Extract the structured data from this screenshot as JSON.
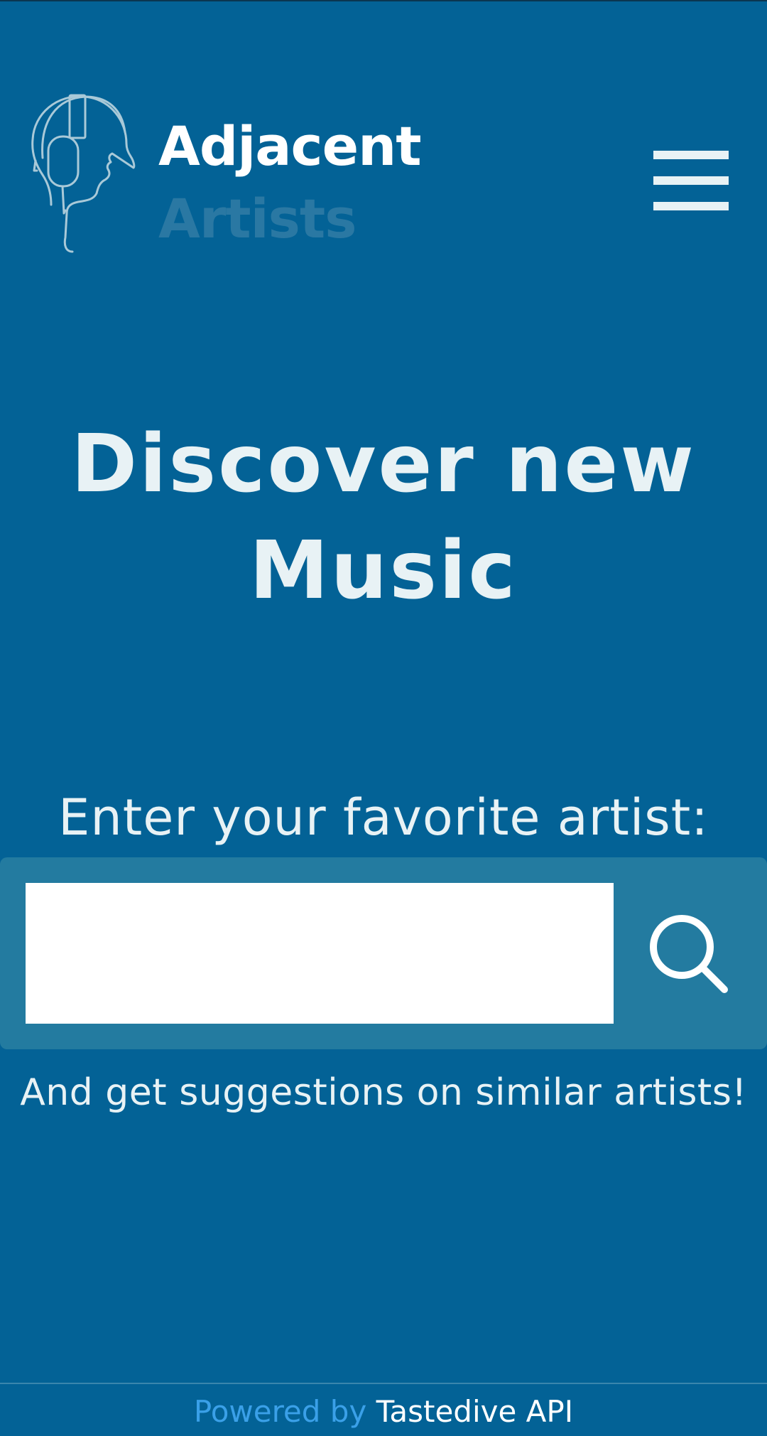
{
  "header": {
    "logo_line1": "Adjacent",
    "logo_line2": "Artists",
    "logo_icon": "headphones-head-icon",
    "menu_icon": "hamburger-menu-icon"
  },
  "hero": {
    "title": "Discover new Music"
  },
  "search": {
    "label": "Enter your favorite artist:",
    "input_value": "",
    "placeholder": "",
    "button_icon": "search-icon"
  },
  "subtext": "And get suggestions on similar artists!",
  "footer": {
    "powered_by": "Powered by",
    "api_name": "Tastedive API"
  },
  "colors": {
    "background": "#036296",
    "panel": "#237ba0",
    "text": "#e8f2f5",
    "logo_accent": "#2a78a3",
    "link": "#3aa0e8"
  }
}
